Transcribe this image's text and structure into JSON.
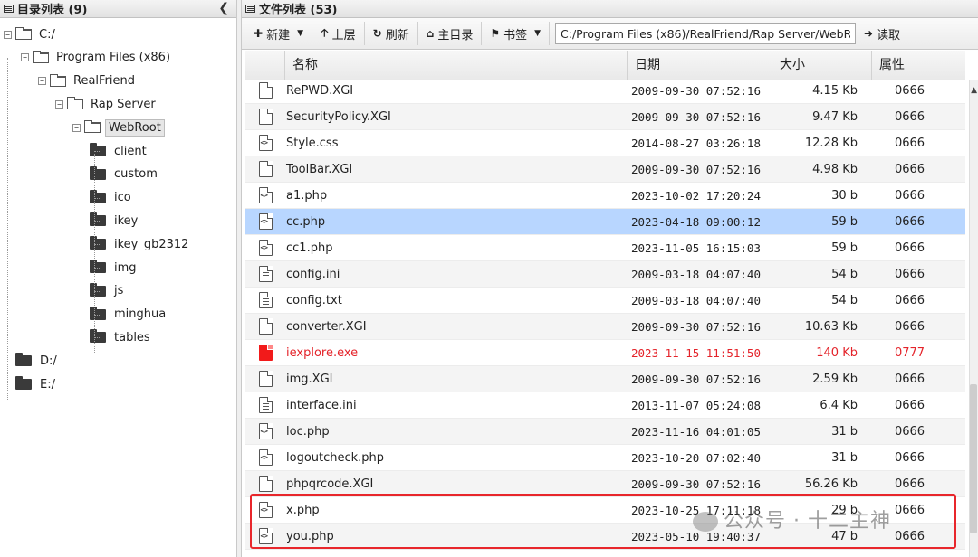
{
  "left_pane": {
    "title": "目录列表 (9)",
    "collapse_icon": "chevron-left-icon",
    "tree": [
      {
        "label": "C:/",
        "level": 0,
        "expanded": true
      },
      {
        "label": "Program Files (x86)",
        "level": 1,
        "expanded": true
      },
      {
        "label": "RealFriend",
        "level": 2,
        "expanded": true
      },
      {
        "label": "Rap Server",
        "level": 3,
        "expanded": true
      },
      {
        "label": "WebRoot",
        "level": 4,
        "expanded": true,
        "selected": true
      },
      {
        "label": "client",
        "level": 5
      },
      {
        "label": "custom",
        "level": 5
      },
      {
        "label": "ico",
        "level": 5
      },
      {
        "label": "ikey",
        "level": 5
      },
      {
        "label": "ikey_gb2312",
        "level": 5
      },
      {
        "label": "img",
        "level": 5
      },
      {
        "label": "js",
        "level": 5
      },
      {
        "label": "minghua",
        "level": 5
      },
      {
        "label": "tables",
        "level": 5
      },
      {
        "label": "D:/",
        "level": 0
      },
      {
        "label": "E:/",
        "level": 0
      }
    ]
  },
  "right_pane": {
    "title": "文件列表 (53)",
    "toolbar": {
      "new_label": "新建",
      "up_label": "上层",
      "refresh_label": "刷新",
      "home_label": "主目录",
      "bookmark_label": "书签",
      "path_value": "C:/Program Files (x86)/RealFriend/Rap Server/WebRoot/",
      "read_label": "读取"
    },
    "columns": {
      "name": "名称",
      "date": "日期",
      "size": "大小",
      "attr": "属性"
    },
    "files": [
      {
        "icon": "file",
        "name": "RePWD.XGI",
        "date": "2009-09-30 07:52:16",
        "size": "4.15 Kb",
        "attr": "0666"
      },
      {
        "icon": "file",
        "name": "SecurityPolicy.XGI",
        "date": "2009-09-30 07:52:16",
        "size": "9.47 Kb",
        "attr": "0666"
      },
      {
        "icon": "code",
        "name": "Style.css",
        "date": "2014-08-27 03:26:18",
        "size": "12.28 Kb",
        "attr": "0666"
      },
      {
        "icon": "file",
        "name": "ToolBar.XGI",
        "date": "2009-09-30 07:52:16",
        "size": "4.98 Kb",
        "attr": "0666"
      },
      {
        "icon": "code",
        "name": "a1.php",
        "date": "2023-10-02 17:20:24",
        "size": "30 b",
        "attr": "0666"
      },
      {
        "icon": "code",
        "name": "cc.php",
        "date": "2023-04-18 09:00:12",
        "size": "59 b",
        "attr": "0666",
        "selected": true
      },
      {
        "icon": "code",
        "name": "cc1.php",
        "date": "2023-11-05 16:15:03",
        "size": "59 b",
        "attr": "0666"
      },
      {
        "icon": "text",
        "name": "config.ini",
        "date": "2009-03-18 04:07:40",
        "size": "54 b",
        "attr": "0666"
      },
      {
        "icon": "text",
        "name": "config.txt",
        "date": "2009-03-18 04:07:40",
        "size": "54 b",
        "attr": "0666"
      },
      {
        "icon": "file",
        "name": "converter.XGI",
        "date": "2009-09-30 07:52:16",
        "size": "10.63 Kb",
        "attr": "0666"
      },
      {
        "icon": "exe",
        "name": "iexplore.exe",
        "date": "2023-11-15 11:51:50",
        "size": "140 Kb",
        "attr": "0777",
        "danger": true
      },
      {
        "icon": "file",
        "name": "img.XGI",
        "date": "2009-09-30 07:52:16",
        "size": "2.59 Kb",
        "attr": "0666"
      },
      {
        "icon": "text",
        "name": "interface.ini",
        "date": "2013-11-07 05:24:08",
        "size": "6.4 Kb",
        "attr": "0666"
      },
      {
        "icon": "code",
        "name": "loc.php",
        "date": "2023-11-16 04:01:05",
        "size": "31 b",
        "attr": "0666"
      },
      {
        "icon": "code",
        "name": "logoutcheck.php",
        "date": "2023-10-20 07:02:40",
        "size": "31 b",
        "attr": "0666"
      },
      {
        "icon": "file",
        "name": "phpqrcode.XGI",
        "date": "2009-09-30 07:52:16",
        "size": "56.26 Kb",
        "attr": "0666"
      },
      {
        "icon": "code",
        "name": "x.php",
        "date": "2023-10-25 17:11:18",
        "size": "29 b",
        "attr": "0666"
      },
      {
        "icon": "code",
        "name": "you.php",
        "date": "2023-05-10 19:40:37",
        "size": "47 b",
        "attr": "0666"
      }
    ]
  },
  "watermark": "公众号 · 十二主神",
  "colors": {
    "selected_row": "#b8d6ff",
    "danger": "#e4232a",
    "highlight_box": "#e8262b"
  }
}
